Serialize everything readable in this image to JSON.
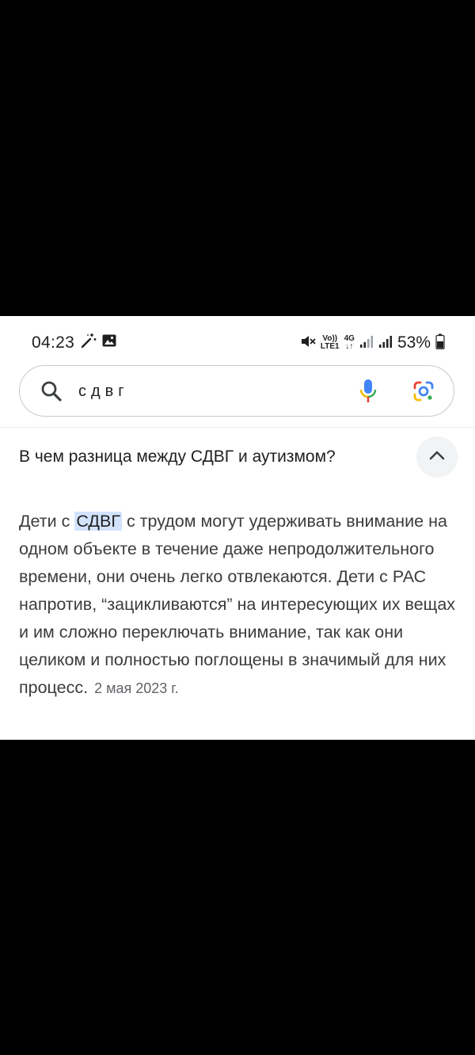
{
  "status_bar": {
    "time": "04:23",
    "volte": "Vo))",
    "lte": "LTE1",
    "network": "4G",
    "battery": "53%"
  },
  "search": {
    "query": "сдвг"
  },
  "result": {
    "question": "В чем разница между СДВГ и аутизмом?",
    "answer_before": "Дети с ",
    "answer_highlight": "СДВГ",
    "answer_after": " с трудом могут удерживать внимание на одном объекте в течение даже непродолжительного времени, они очень легко отвлекаются. Дети с РАС напротив, “зацикливаются” на интересующих их вещах и им сложно переключать внимание, так как они целиком и полностью поглощены в значимый для них процесс.",
    "date": "2 мая 2023 г."
  },
  "colors": {
    "highlight": "#d3e3fd",
    "mic_blue": "#4285f4",
    "mic_red": "#ea4335"
  }
}
